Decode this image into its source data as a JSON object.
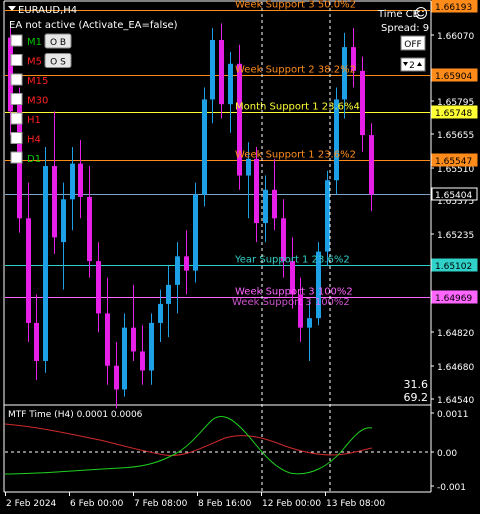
{
  "chart": {
    "symbol_title": "EURAUD,H4",
    "ea_status": "EA not active (Activate_EA=false)",
    "spread_label": "Spread: 9",
    "time_label": "Time CB",
    "off_label": "OFF",
    "zoom_label": "2",
    "readout_top": "31.6",
    "readout_bottom": "69.2"
  },
  "timeframes": [
    {
      "label": "M1",
      "color": "#00c800",
      "button": "O B"
    },
    {
      "label": "M5",
      "color": "#ff2020",
      "button": "O S"
    },
    {
      "label": "M15",
      "color": "#ff2020"
    },
    {
      "label": "M30",
      "color": "#ff2020"
    },
    {
      "label": "H1",
      "color": "#ff2020"
    },
    {
      "label": "H4",
      "color": "#ff2020"
    },
    {
      "label": "D1",
      "color": "#00c800"
    }
  ],
  "levels": [
    {
      "name": "Week Support 3 50.0%2",
      "price": 1.66176,
      "color": "#ff8c1a",
      "tag": "1.66193",
      "tag_bg": "#ff8c1a",
      "tag_fg": "#000000",
      "line": "solid"
    },
    {
      "name": "Week Support 2 38.2%2",
      "price": 1.65904,
      "color": "#ff8c1a",
      "tag": "1.65904",
      "tag_bg": "#ff8c1a",
      "tag_fg": "#000000",
      "line": "solid"
    },
    {
      "name": "Month Support 1 23.6%4",
      "price": 1.65748,
      "color": "#ffff33",
      "tag": "1.65748",
      "tag_bg": "#ffff33",
      "tag_fg": "#000000",
      "line": "solid"
    },
    {
      "name": "Week Support 1 23.6%2",
      "price": 1.65547,
      "color": "#ff8c1a",
      "tag": "1.65547",
      "tag_bg": "#ff8c1a",
      "tag_fg": "#000000",
      "line": "solid"
    },
    {
      "name": "",
      "price": 1.65404,
      "color": "#7fa6c8",
      "tag": "1.65404",
      "tag_bg": "#000000",
      "tag_fg": "#ffffff",
      "line": "solid"
    },
    {
      "name": "Year Support 1 23.6%2",
      "price": 1.65102,
      "color": "#2fd1c8",
      "tag": "1.65102",
      "tag_bg": "#2fd1c8",
      "tag_fg": "#000000",
      "line": "solid"
    },
    {
      "name": "Week Support 3 100%2",
      "price": 1.64969,
      "color": "#ff66ff",
      "tag": "1.64969",
      "tag_bg": "#ff66ff",
      "tag_fg": "#000000",
      "line": "solid"
    }
  ],
  "price_axis": [
    {
      "v": 1.6607,
      "t": "1.66070"
    },
    {
      "v": 1.65795,
      "t": "1.65795"
    },
    {
      "v": 1.65655,
      "t": "1.65655"
    },
    {
      "v": 1.6551,
      "t": "1.65510"
    },
    {
      "v": 1.65375,
      "t": "1.65375"
    },
    {
      "v": 1.65235,
      "t": "1.65235"
    },
    {
      "v": 1.6482,
      "t": "1.64820"
    },
    {
      "v": 1.6468,
      "t": "1.64680"
    },
    {
      "v": 1.6454,
      "t": "1.64540"
    }
  ],
  "time_axis": [
    "2 Feb 2024",
    "6 Feb 00:00",
    "7 Feb 08:00",
    "8 Feb 16:00",
    "12 Feb 00:00",
    "13 Feb 08:00"
  ],
  "indicator": {
    "title": "MTF Time (H4) 0.0001 0.0006",
    "axis": [
      "0.0011",
      "0.00",
      "-0.001"
    ]
  },
  "chart_data": {
    "type": "candlestick",
    "ylim": [
      1.6454,
      1.6621
    ],
    "candles": [
      [
        1.6606,
        1.6612,
        1.6565,
        1.6575
      ],
      [
        1.6578,
        1.6585,
        1.6524,
        1.653
      ],
      [
        1.653,
        1.6545,
        1.6478,
        1.6486
      ],
      [
        1.6486,
        1.6498,
        1.6462,
        1.647
      ],
      [
        1.647,
        1.656,
        1.6465,
        1.6552
      ],
      [
        1.6552,
        1.6575,
        1.6515,
        1.6522
      ],
      [
        1.652,
        1.6545,
        1.65,
        1.6538
      ],
      [
        1.6538,
        1.656,
        1.6525,
        1.6553
      ],
      [
        1.6553,
        1.6563,
        1.653,
        1.6539
      ],
      [
        1.6539,
        1.6552,
        1.6505,
        1.6512
      ],
      [
        1.6512,
        1.652,
        1.6482,
        1.649
      ],
      [
        1.649,
        1.6505,
        1.646,
        1.6468
      ],
      [
        1.6468,
        1.6478,
        1.645,
        1.6458
      ],
      [
        1.6458,
        1.649,
        1.6455,
        1.6484
      ],
      [
        1.6484,
        1.6502,
        1.647,
        1.6474
      ],
      [
        1.6474,
        1.6485,
        1.646,
        1.6466
      ],
      [
        1.6466,
        1.649,
        1.646,
        1.6486
      ],
      [
        1.6486,
        1.65,
        1.6478,
        1.6494
      ],
      [
        1.6494,
        1.651,
        1.648,
        1.6502
      ],
      [
        1.6502,
        1.652,
        1.649,
        1.6514
      ],
      [
        1.6514,
        1.6525,
        1.6498,
        1.6508
      ],
      [
        1.6508,
        1.6545,
        1.6503,
        1.654
      ],
      [
        1.654,
        1.6585,
        1.6535,
        1.658
      ],
      [
        1.658,
        1.661,
        1.657,
        1.6605
      ],
      [
        1.6605,
        1.6612,
        1.6572,
        1.6578
      ],
      [
        1.6578,
        1.66,
        1.6566,
        1.6595
      ],
      [
        1.6595,
        1.6603,
        1.6542,
        1.6548
      ],
      [
        1.6548,
        1.6562,
        1.653,
        1.6555
      ],
      [
        1.6555,
        1.656,
        1.652,
        1.6528
      ],
      [
        1.6528,
        1.6548,
        1.652,
        1.6542
      ],
      [
        1.6542,
        1.6555,
        1.6525,
        1.653
      ],
      [
        1.653,
        1.6538,
        1.6505,
        1.6512
      ],
      [
        1.6512,
        1.6522,
        1.6492,
        1.6498
      ],
      [
        1.6498,
        1.6505,
        1.6478,
        1.6484
      ],
      [
        1.6484,
        1.6495,
        1.647,
        1.6488
      ],
      [
        1.6488,
        1.652,
        1.6485,
        1.6516
      ],
      [
        1.6516,
        1.655,
        1.651,
        1.6546
      ],
      [
        1.6546,
        1.6585,
        1.654,
        1.658
      ],
      [
        1.658,
        1.6608,
        1.6572,
        1.6602
      ],
      [
        1.6602,
        1.661,
        1.6585,
        1.6592
      ],
      [
        1.6592,
        1.6598,
        1.6558,
        1.6565
      ],
      [
        1.6565,
        1.657,
        1.6533,
        1.654
      ]
    ]
  }
}
